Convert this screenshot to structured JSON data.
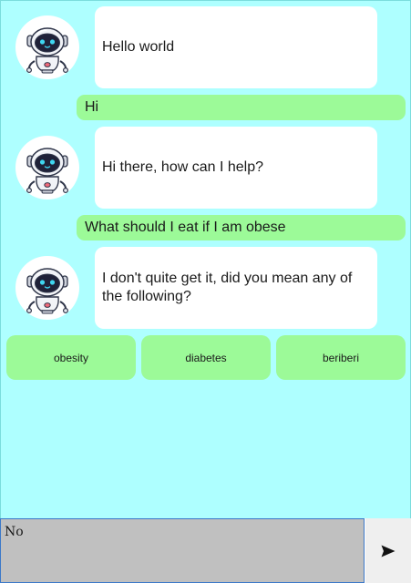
{
  "messages": [
    {
      "role": "bot",
      "text": "Hello world"
    },
    {
      "role": "user",
      "text": "Hi"
    },
    {
      "role": "bot",
      "text": "Hi there, how can I help?"
    },
    {
      "role": "user",
      "text": "What should I eat if I am obese"
    },
    {
      "role": "bot",
      "text": "I don't quite get it, did you mean any of the following?"
    }
  ],
  "suggestions": [
    "obesity",
    "diabetes",
    "beriberi"
  ],
  "input": {
    "value": "No"
  },
  "icons": {
    "avatar": "robot-avatar-icon",
    "send": "send-arrow-icon"
  },
  "colors": {
    "chat_background": "#aeffff",
    "bot_bubble": "#ffffff",
    "user_bubble": "#9cfa98",
    "suggestion_button": "#9cfa98",
    "input_background": "#c0c0c0",
    "send_button": "#efefef"
  }
}
